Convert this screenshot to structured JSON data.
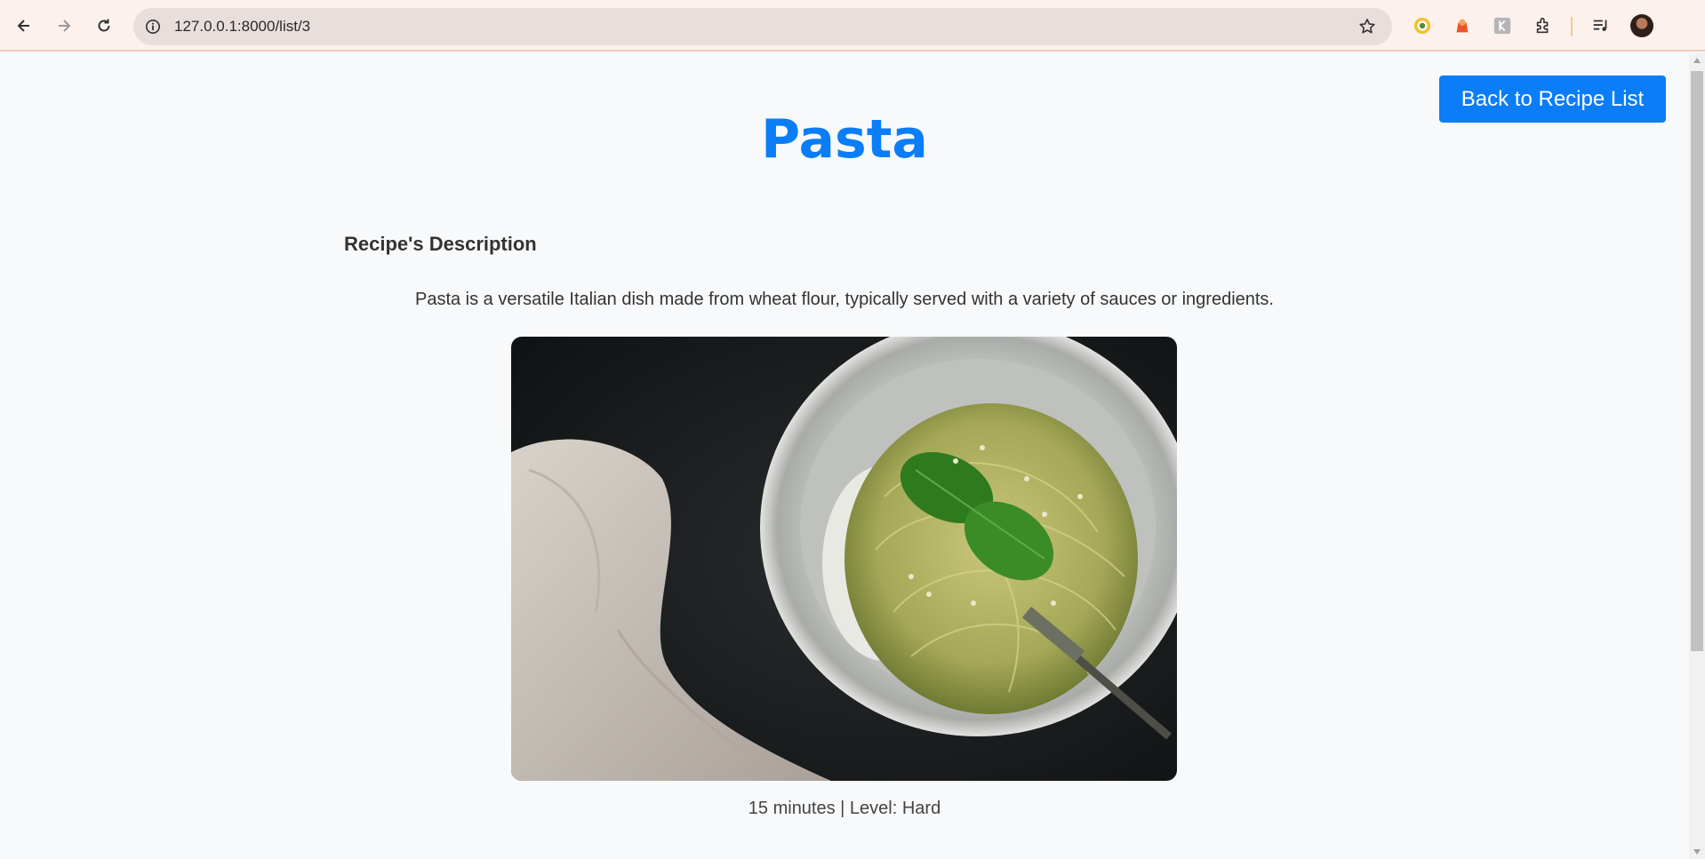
{
  "browser": {
    "url": "127.0.0.1:8000/list/3"
  },
  "header": {
    "back_button_label": "Back to Recipe List"
  },
  "recipe": {
    "title": "Pasta",
    "description_heading": "Recipe's Description",
    "description": "Pasta is a versatile Italian dish made from wheat flour, typically served with a variety of sauces or ingredients.",
    "meta": "15 minutes | Level: Hard"
  },
  "colors": {
    "accent": "#0a7df7",
    "text": "#333333",
    "background": "#f7f9fb"
  }
}
